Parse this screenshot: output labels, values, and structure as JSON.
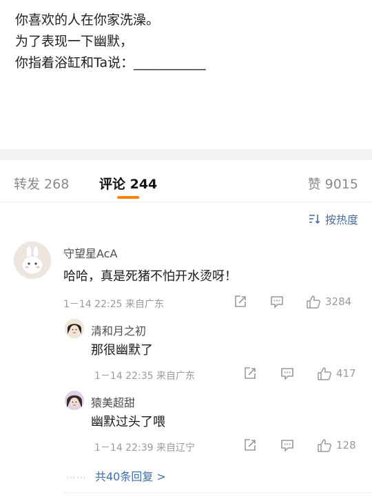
{
  "post": {
    "lines": [
      "你喜欢的人在你家洗澡。",
      "为了表现一下幽默，",
      "你指着浴缸和Ta说：___________"
    ]
  },
  "tabs": {
    "repost": "转发 268",
    "comment": "评论 244",
    "like": "赞 9015"
  },
  "sort": {
    "label": "按热度",
    "icon": "sort-lines-icon"
  },
  "comment": {
    "username": "守望星AcA",
    "text": "哈哈，真是死猪不怕开水烫呀！",
    "meta": "1－14 22:25 来自广东",
    "likes": "3284"
  },
  "replies": [
    {
      "username": "清和月之初",
      "text": "那很幽默了",
      "meta": "1－14 22:35 来自广东",
      "likes": "417"
    },
    {
      "username": "猿美超甜",
      "text": "幽默过头了喂",
      "meta": "1－14 22:39 来自辽宁",
      "likes": "128"
    }
  ],
  "more_replies": "共40条回复 >",
  "colors": {
    "accent": "#ff8200",
    "link": "#3e6ea8",
    "muted": "#9a9a9a"
  }
}
